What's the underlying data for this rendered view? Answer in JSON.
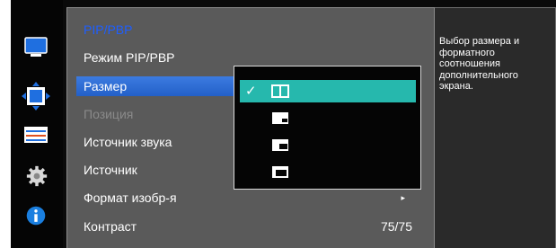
{
  "menu": {
    "title": "PIP/PBP",
    "items": [
      {
        "label": "Режим PIP/PBP",
        "state": "normal",
        "value": ""
      },
      {
        "label": "Размер",
        "state": "selected",
        "value": ""
      },
      {
        "label": "Позиция",
        "state": "disabled",
        "value": ""
      },
      {
        "label": "Источник звука",
        "state": "normal",
        "value": ""
      },
      {
        "label": "Источник",
        "state": "normal",
        "value": ""
      },
      {
        "label": "Формат изобр-я",
        "state": "normal",
        "value": "",
        "arrow": "▸"
      },
      {
        "label": "Контраст",
        "state": "normal",
        "value": "75/75"
      }
    ]
  },
  "size_dropdown": {
    "check": "✓",
    "options": [
      {
        "icon": "pbp-side-by-side-icon",
        "selected": true
      },
      {
        "icon": "pip-small-icon",
        "selected": false
      },
      {
        "icon": "pip-medium-icon",
        "selected": false
      },
      {
        "icon": "pip-large-icon",
        "selected": false
      }
    ]
  },
  "description": "Выбор размера и форматного соотношения дополнительного экрана.",
  "sidebar_icons": [
    "monitor-icon",
    "move-arrows-icon",
    "adjust-bars-icon",
    "settings-gear-icon",
    "info-icon"
  ],
  "colors": {
    "accent_blue": "#2a6ad8",
    "title_blue": "#1e5eff",
    "option_highlight": "#26b8ad",
    "panel_gray": "#5a5a5a",
    "info_blue": "#1a7fe0"
  }
}
